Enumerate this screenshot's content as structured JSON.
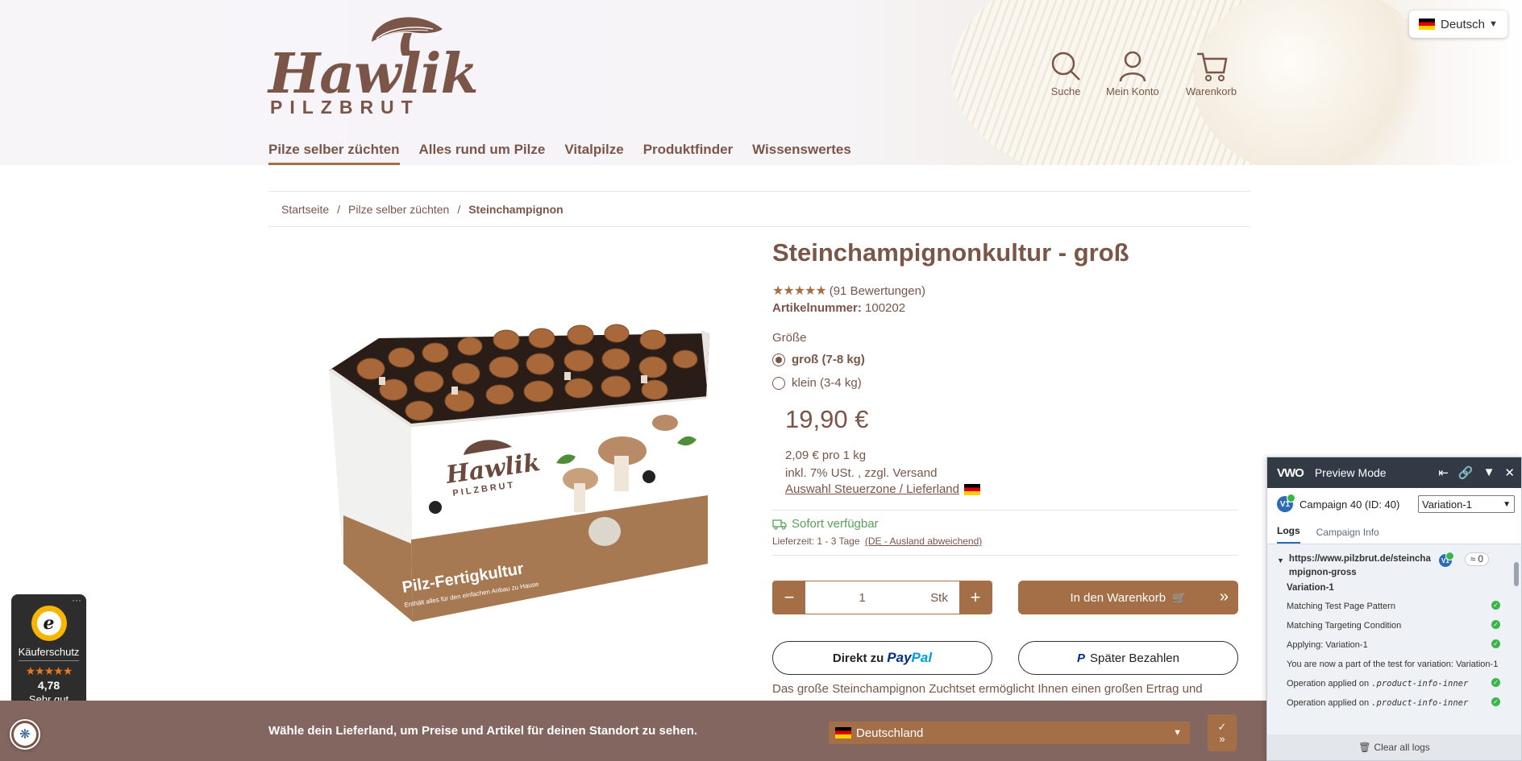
{
  "header": {
    "logo_word": "Hawlik",
    "logo_sub": "PILZBRUT",
    "icons": [
      {
        "name": "search-icon",
        "label": "Suche"
      },
      {
        "name": "user-icon",
        "label": "Mein Konto"
      },
      {
        "name": "cart-icon",
        "label": "Warenkorb"
      }
    ],
    "language": "Deutsch"
  },
  "nav": {
    "items": [
      "Pilze selber züchten",
      "Alles rund um Pilze",
      "Vitalpilze",
      "Produktfinder",
      "Wissenswertes"
    ],
    "active_index": 0
  },
  "breadcrumb": [
    "Startseite",
    "Pilze selber züchten",
    "Steinchampignon"
  ],
  "product": {
    "title": "Steinchampignonkultur - groß",
    "stars": "★★★★★",
    "reviews": "(91 Bewertungen)",
    "article_label": "Artikelnummer:",
    "article_number": "100202",
    "size_label": "Größe",
    "options": [
      {
        "label": "groß (7-8 kg)",
        "selected": true
      },
      {
        "label": "klein (3-4 kg)",
        "selected": false
      }
    ],
    "price": "19,90 €",
    "unit_price": "2,09 € pro 1 kg",
    "tax_note": "inkl. 7% USt. , zzgl. Versand",
    "tax_zone_link": "Auswahl Steuerzone / Lieferland",
    "availability": "Sofort verfügbar",
    "delivery_label": "Lieferzeit: 1 - 3 Tage",
    "delivery_link": "(DE - Ausland abweichend)",
    "quantity": "1",
    "quantity_unit": "Stk",
    "add_to_cart": "In den Warenkorb",
    "paypal_direct_prefix": "Direkt zu",
    "paypal_brand_1": "Pay",
    "paypal_brand_2": "Pal",
    "paypal_later": "Später Bezahlen",
    "description": "Das große Steinchampignon Zuchtset ermöglicht Ihnen einen großen Ertrag und",
    "image": {
      "box_brand": "Hawlik",
      "box_sub": "PILZBRUT",
      "box_title": "Pilz-Fertigkultur",
      "box_tagline": "Enthält alles für den einfachen Anbau zu Hause"
    }
  },
  "trusted_shops": {
    "label": "Käuferschutz",
    "stars": "★★★★★",
    "score": "4,78",
    "rating_text": "Sehr gut",
    "menu": "···"
  },
  "country_bar": {
    "message": "Wähle dein Lieferland, um Preise und Artikel für deinen Standort zu sehen.",
    "selected_country": "Deutschland",
    "confirm_check": "✓",
    "confirm_arrow": "»"
  },
  "vwo": {
    "logo": "VWO",
    "title": "Preview Mode",
    "badge": "V1",
    "campaign": "Campaign 40 (ID: 40)",
    "variation_select": "Variation-1",
    "tabs": [
      "Logs",
      "Campaign Info"
    ],
    "log_url": "https://www.pilzbrut.de/steinchampignon-gross",
    "log_count": "0",
    "log_variation": "Variation-1",
    "log_lines": [
      {
        "text": "Matching Test Page Pattern",
        "check": true
      },
      {
        "text": "Matching Targeting Condition",
        "check": true
      },
      {
        "text": "Applying: Variation-1",
        "check": true
      },
      {
        "text": "You are now a part of the test for variation: Variation-1",
        "check": false
      }
    ],
    "op_lines": [
      {
        "prefix": "Operation applied on",
        "selector": ".product-info-inner"
      },
      {
        "prefix": "Operation applied on",
        "selector": ".product-info-inner"
      }
    ],
    "clear": "Clear all logs"
  },
  "colors": {
    "brand_brown": "#7a5548",
    "accent_copper": "#a46f47",
    "bar_bg": "#836660",
    "vwo_header": "#323a45",
    "available_green": "#5aa05a"
  }
}
